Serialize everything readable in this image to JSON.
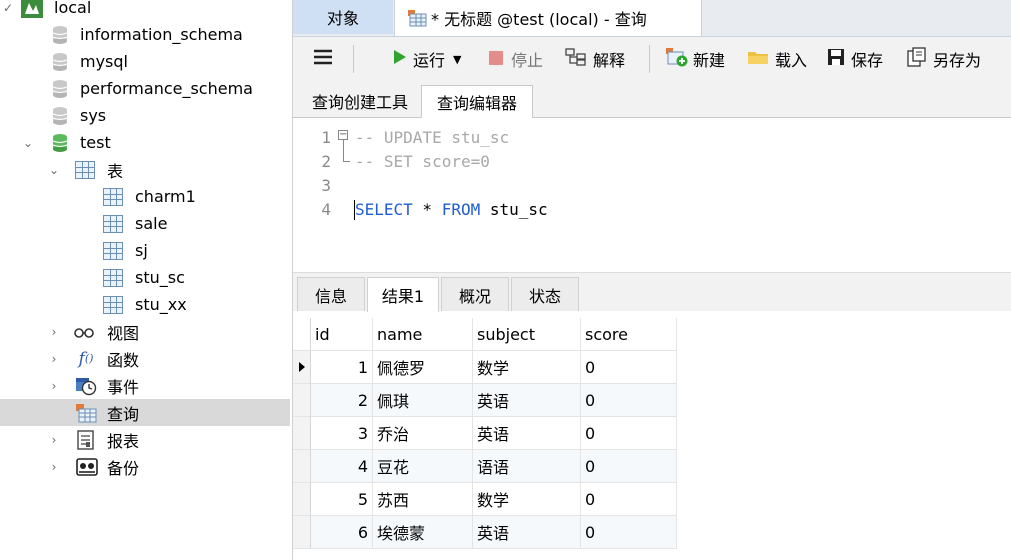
{
  "navigator": {
    "connection": "local",
    "databases_above": [
      "information_schema",
      "mysql",
      "performance_schema",
      "sys"
    ],
    "active_db": "test",
    "tables_group": "表",
    "tables": [
      "charm1",
      "sale",
      "sj",
      "stu_sc",
      "stu_xx"
    ],
    "groups": [
      {
        "label": "视图",
        "icon": "glasses-icon"
      },
      {
        "label": "函数",
        "icon": "function-icon"
      },
      {
        "label": "事件",
        "icon": "event-clock-icon"
      },
      {
        "label": "查询",
        "icon": "query-icon",
        "selected": true
      },
      {
        "label": "报表",
        "icon": "report-icon"
      },
      {
        "label": "备份",
        "icon": "backup-icon"
      }
    ]
  },
  "tabs": {
    "objects": "对象",
    "query_tab": "* 无标题 @test (local) - 查询"
  },
  "toolbar": {
    "menu_icon": "hamburger-icon",
    "run": "运行",
    "stop": "停止",
    "explain": "解释",
    "new": "新建",
    "load": "载入",
    "save": "保存",
    "save_as": "另存为"
  },
  "subtabs": {
    "builder": "查询创建工具",
    "editor": "查询编辑器"
  },
  "editor": {
    "line_numbers": [
      "1",
      "2",
      "3",
      "4"
    ],
    "line1": "-- UPDATE stu_sc",
    "line2": "-- SET score=0",
    "line3": "",
    "line4_kw1": "SELECT",
    "line4_mid": " * ",
    "line4_kw2": "FROM",
    "line4_rest": " stu_sc"
  },
  "result_tabs": [
    "信息",
    "结果1",
    "概况",
    "状态"
  ],
  "result": {
    "columns": [
      "id",
      "name",
      "subject",
      "score"
    ],
    "rows": [
      [
        "1",
        "佩德罗",
        "数学",
        "0"
      ],
      [
        "2",
        "佩琪",
        "英语",
        "0"
      ],
      [
        "3",
        "乔治",
        "英语",
        "0"
      ],
      [
        "4",
        "豆花",
        "语语",
        "0"
      ],
      [
        "5",
        "苏西",
        "数学",
        "0"
      ],
      [
        "6",
        "埃德蒙",
        "英语",
        "0"
      ]
    ]
  },
  "colors": {
    "accent": "#cfe0f5",
    "run_green": "#2fa52f",
    "stop_red": "#e48b8b",
    "keyword_blue": "#1f5cd6",
    "comment_gray": "#a8a8a8",
    "db_green": "#5cb85c"
  }
}
